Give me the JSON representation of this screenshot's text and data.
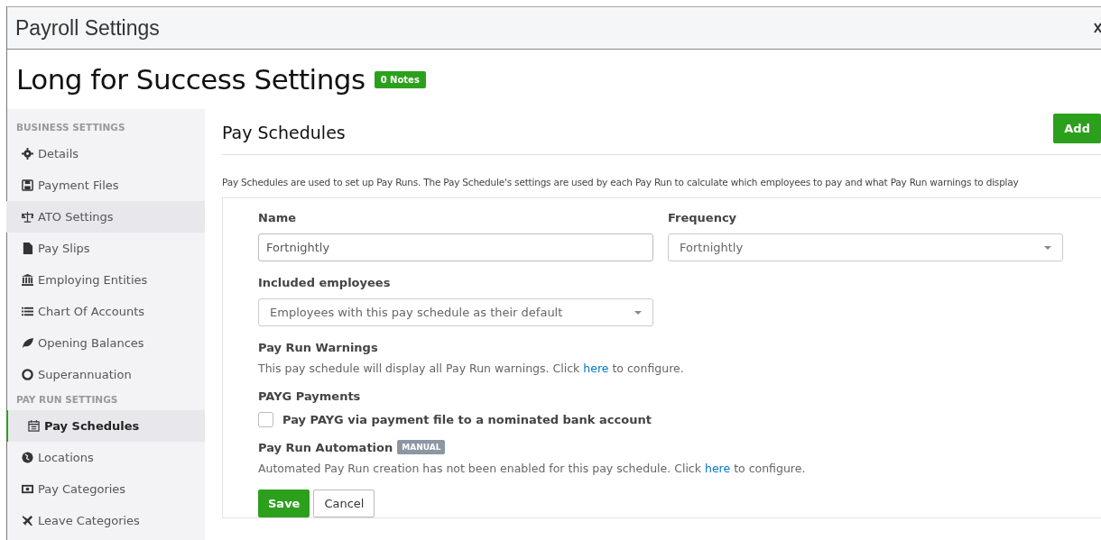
{
  "window": {
    "title": "Payroll Settings"
  },
  "page_title": "Long for Success Settings",
  "notes_badge": "0 Notes",
  "sidebar": {
    "sections": [
      {
        "heading": "BUSINESS SETTINGS",
        "items": [
          {
            "label": "Details",
            "selected": false
          },
          {
            "label": "Payment Files",
            "selected": false
          },
          {
            "label": "ATO Settings",
            "selected": false,
            "hovered": true
          },
          {
            "label": "Pay Slips",
            "selected": false
          },
          {
            "label": "Employing Entities",
            "selected": false
          },
          {
            "label": "Chart Of Accounts",
            "selected": false
          },
          {
            "label": "Opening Balances",
            "selected": false
          },
          {
            "label": "Superannuation",
            "selected": false
          }
        ]
      },
      {
        "heading": "PAY RUN SETTINGS",
        "items": [
          {
            "label": "Pay Schedules",
            "selected": true
          },
          {
            "label": "Locations",
            "selected": false
          },
          {
            "label": "Pay Categories",
            "selected": false
          },
          {
            "label": "Leave Categories",
            "selected": false
          }
        ]
      }
    ]
  },
  "main": {
    "title": "Pay Schedules",
    "add_button": "Add",
    "description": "Pay Schedules are used to set up Pay Runs. The Pay Schedule's settings are used by each Pay Run to calculate which employees to pay and what Pay Run warnings to display",
    "form": {
      "name_label": "Name",
      "name_value": "Fortnightly",
      "frequency_label": "Frequency",
      "frequency_value": "Fortnightly",
      "included_label": "Included employees",
      "included_value": "Employees with this pay schedule as their default",
      "warnings_label": "Pay Run Warnings",
      "warnings_text": "This pay schedule will display all Pay Run warnings. Click",
      "warnings_link": "here",
      "warnings_suffix": "to configure.",
      "payg_label": "PAYG Payments",
      "payg_checkbox": {
        "label": "Pay PAYG via payment file to a nominated bank account",
        "checked": false
      },
      "automation_label": "Pay Run Automation",
      "automation_badge": "MANUAL",
      "automation_text": "Automated Pay Run creation has not been enabled for this pay schedule. Click",
      "automation_link": "here",
      "automation_suffix": "to configure."
    },
    "buttons": [
      "Save",
      "Cancel"
    ]
  }
}
